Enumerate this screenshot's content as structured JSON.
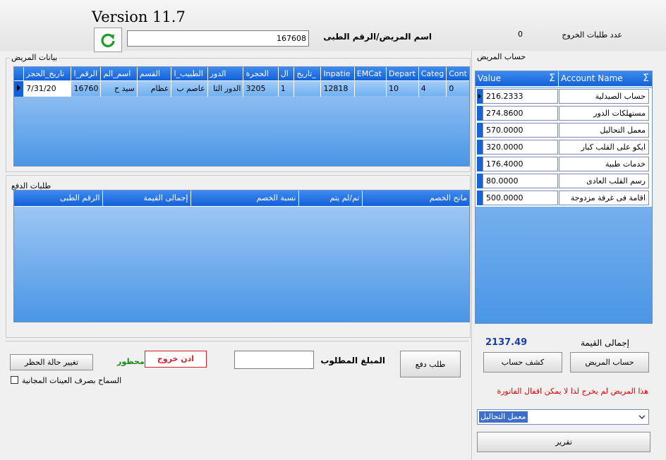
{
  "app": {
    "version": "Version 11.7"
  },
  "header": {
    "discharge_requests_label": "عدد طلبات الخروج",
    "discharge_requests_count": "0",
    "patient_label": "اسم المريض/الرقم الطبى",
    "patient_id_value": "167608"
  },
  "patient_data": {
    "title": "بيانات المريض",
    "columns": [
      "Cont",
      "Categ",
      "Depart",
      "EMCat",
      "Inpatie",
      "تاريخ_",
      "ال",
      "الحجرة",
      "الدور",
      "الطبيب_ا",
      "القسم",
      "اسم_الم",
      "الرقم_ا",
      "تاريخ_الحجز"
    ],
    "row": [
      "0",
      "4",
      "10",
      "",
      "12818",
      "",
      "1",
      "3205",
      "الدور الثا",
      "عاصم ب",
      "عظام",
      "سيد ح",
      "16760",
      "7/31/20"
    ]
  },
  "payment_requests": {
    "title": "طلبات الدفع",
    "columns": [
      "مانح الخصم",
      "تم/لم يتم",
      "نسبة الخصم",
      "إجمالى القيمة",
      "الرقم الطبى"
    ]
  },
  "bottom": {
    "amount_label": "المبلغ المطلوب",
    "amount_value": "",
    "pay_request_button": "طلب دفع",
    "exit_permit": "اذن خروج",
    "banned_label": "محظور",
    "change_ban_button": "تغيير حالة الحظر",
    "free_samples_label": "السماح بصرف العينات المجانية"
  },
  "account": {
    "title": "حساب المريض",
    "columns": {
      "value": "Value",
      "name": "Account Name"
    },
    "rows": [
      {
        "value": "216.2333",
        "name": "حساب الصيدلية"
      },
      {
        "value": "274.8600",
        "name": "مستهلكات الدور"
      },
      {
        "value": "570.0000",
        "name": "معمل التحاليل"
      },
      {
        "value": "320.0000",
        "name": "ايكو على القلب كبار"
      },
      {
        "value": "176.4000",
        "name": "خدمات طبية"
      },
      {
        "value": "80.0000",
        "name": "رسم القلب العادى"
      },
      {
        "value": "500.0000",
        "name": "اقامة فى غرفة مزدوجة"
      }
    ],
    "total_label": "إجمالى القيمة",
    "total_value": "2137.49",
    "statement_button": "كشف حساب",
    "patient_account_button": "حساب المريض",
    "warning": "هذا المريض لم يخرج لذا لا يمكن اقفال الفاتورة",
    "report_select": "معمل التحاليل",
    "report_button": "تقرير"
  },
  "colors": {
    "header_blue": "#1460d8",
    "grid_blue": "#4a96e6",
    "warning_red": "#e00000",
    "total_blue": "#1a3fa8",
    "banned_green": "#1a8a1a"
  }
}
